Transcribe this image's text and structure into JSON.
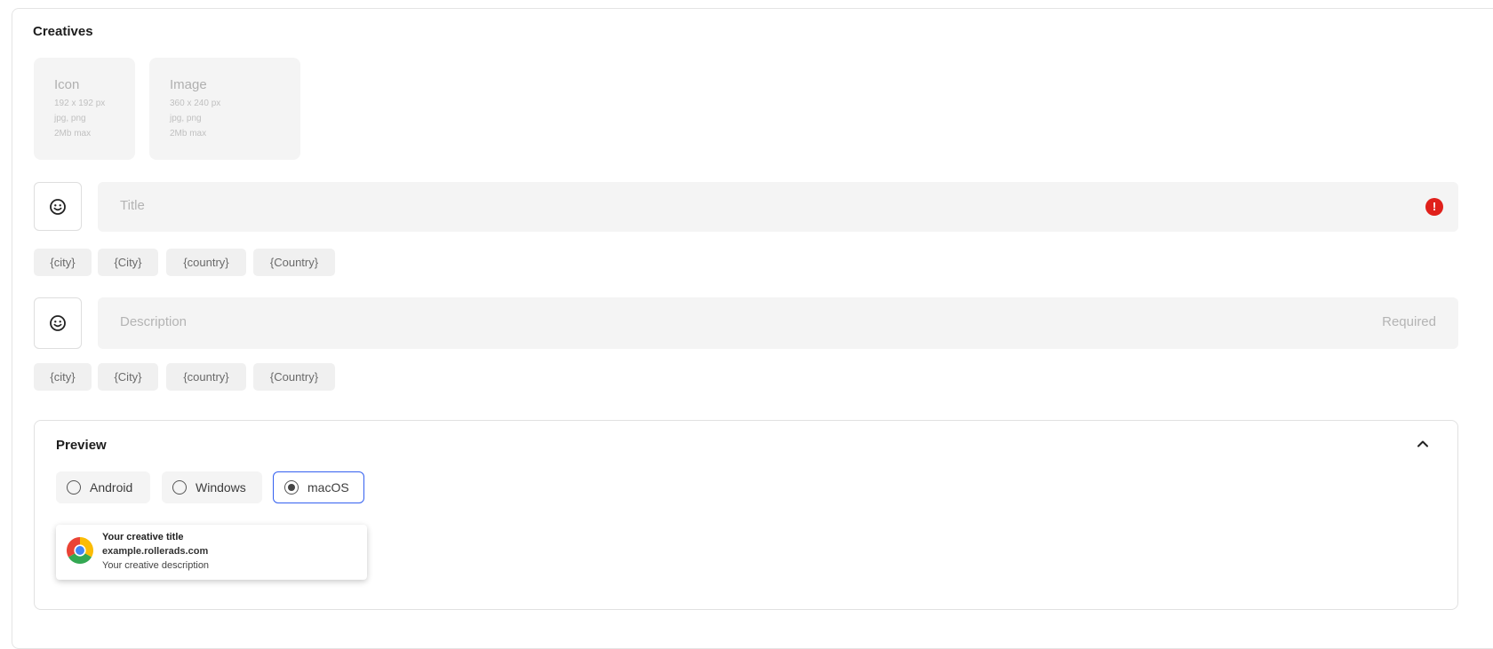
{
  "creatives": {
    "title": "Creatives",
    "uploads": [
      {
        "title": "Icon",
        "lines": [
          "192 x 192 px",
          "jpg, png",
          "2Mb max"
        ]
      },
      {
        "title": "Image",
        "lines": [
          "360 x 240 px",
          "jpg, png",
          "2Mb max"
        ]
      }
    ],
    "title_field": {
      "placeholder": "Title",
      "error_icon": "!"
    },
    "description_field": {
      "placeholder": "Description",
      "required_label": "Required"
    },
    "macros": [
      "{city}",
      "{City}",
      "{country}",
      "{Country}"
    ]
  },
  "preview": {
    "title": "Preview",
    "options": [
      {
        "label": "Android",
        "selected": false
      },
      {
        "label": "Windows",
        "selected": false
      },
      {
        "label": "macOS",
        "selected": true
      }
    ],
    "notification": {
      "title": "Your creative title",
      "url": "example.rollerads.com",
      "description": "Your creative description",
      "icon": "chrome-icon"
    }
  },
  "colors": {
    "accent": "#3460f0",
    "error": "#e0201b"
  }
}
